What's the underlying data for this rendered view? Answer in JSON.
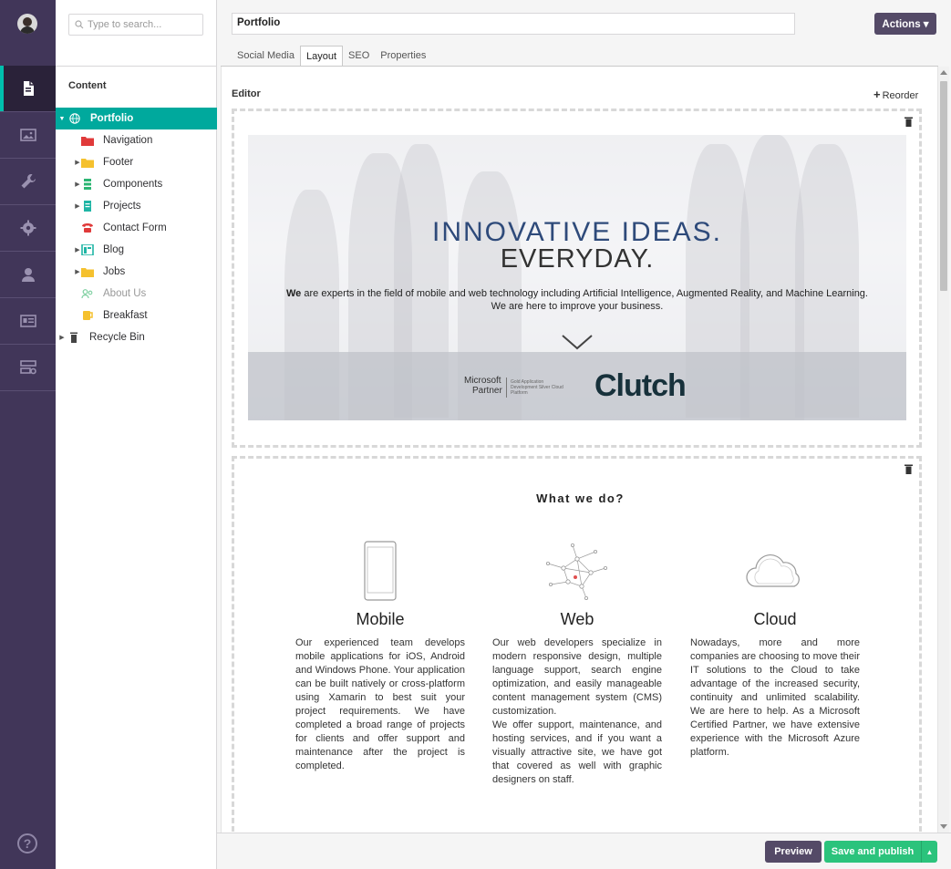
{
  "search": {
    "placeholder": "Type to search..."
  },
  "tree": {
    "heading": "Content",
    "nodes": [
      {
        "label": "Portfolio",
        "icon": "globe-icon"
      },
      {
        "label": "Navigation",
        "icon": "folder-red-icon"
      },
      {
        "label": "Footer",
        "icon": "folder-yellow-icon"
      },
      {
        "label": "Components",
        "icon": "list-icon"
      },
      {
        "label": "Projects",
        "icon": "document-icon"
      },
      {
        "label": "Contact Form",
        "icon": "phone-icon"
      },
      {
        "label": "Blog",
        "icon": "layout-icon"
      },
      {
        "label": "Jobs",
        "icon": "folder-yellow-icon"
      },
      {
        "label": "About Us",
        "icon": "people-icon"
      },
      {
        "label": "Breakfast",
        "icon": "cup-icon"
      },
      {
        "label": "Recycle Bin",
        "icon": "trash-icon"
      }
    ]
  },
  "header": {
    "title_value": "Portfolio",
    "actions_label": "Actions ▾",
    "tabs": [
      "Social Media",
      "Layout",
      "SEO",
      "Properties"
    ],
    "active_tab": "Layout"
  },
  "editor": {
    "label": "Editor",
    "reorder_label": "Reorder",
    "hero": {
      "title_line1": "INNOVATIVE IDEAS.",
      "title_line2": "EVERYDAY.",
      "text_bold": "We",
      "text_rest": " are experts in the field of mobile and web technology including Artificial Intelligence, Augmented Reality, and Machine Learning.",
      "text_line2": "We are here to improve your business.",
      "ms_logo_line1": "Microsoft",
      "ms_logo_line2": "Partner",
      "ms_logo_small": "Gold Application Development Silver Cloud Platform",
      "clutch_logo": "Clutch"
    },
    "whatwedo": {
      "title": "What we do?",
      "columns": [
        {
          "title": "Mobile",
          "icon": "phone-outline-icon",
          "text": "Our experienced team develops mobile applications for iOS, Android and Windows Phone. Your application can be built natively or cross-platform using Xamarin to best suit your project requirements. We have completed a broad range of projects for clients and offer support and maintenance after the project is completed."
        },
        {
          "title": "Web",
          "icon": "network-icon",
          "text": "Our web developers specialize in modern responsive design, multiple language support, search engine optimization, and easily manageable content management system (CMS) customization.",
          "text2": "We offer support, maintenance, and hosting services, and if you want a visually attractive site, we have got that covered as well with graphic designers on staff."
        },
        {
          "title": "Cloud",
          "icon": "cloud-icon",
          "text": "Nowadays, more and more companies are choosing to move their IT solutions to the Cloud to take advantage of the increased security, continuity and unlimited scalability. We are here to help. As a Microsoft Certified Partner, we have extensive experience with the Microsoft Azure platform."
        }
      ]
    }
  },
  "footer": {
    "preview_label": "Preview",
    "publish_label": "Save and publish"
  },
  "help_label": "?",
  "colors": {
    "sidebar": "#413659",
    "accent": "#00bfad",
    "selected": "#00a99d",
    "publish": "#2bc37c",
    "button": "#544a67"
  }
}
